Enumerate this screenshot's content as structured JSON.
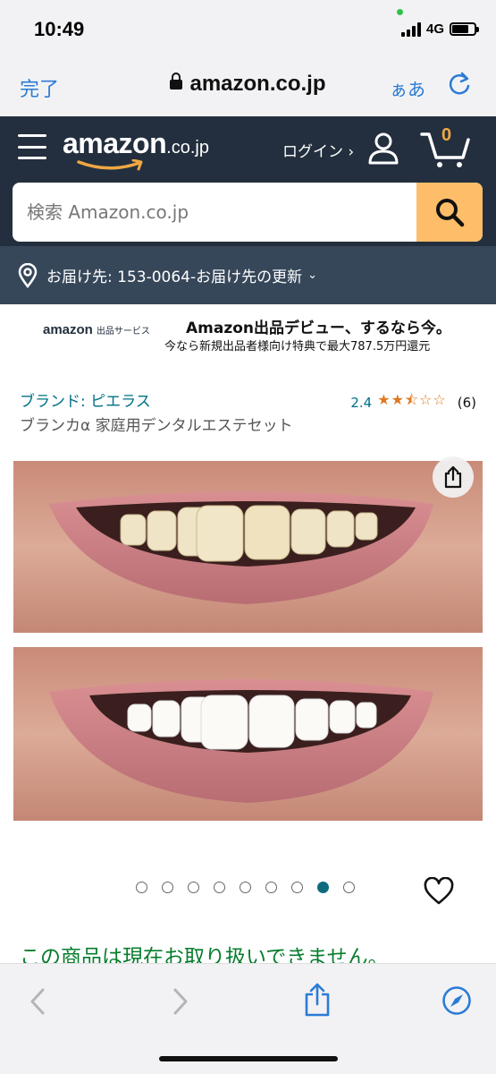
{
  "status_bar": {
    "time": "10:49",
    "network": "4G"
  },
  "browser": {
    "done_label": "完了",
    "url": "amazon.co.jp",
    "text_size_label": "ぁあ"
  },
  "amazon_header": {
    "logo_word": "amazon",
    "logo_tld": ".co.jp",
    "login_label": "ログイン ›",
    "cart_count": "0",
    "search_placeholder": "検索 Amazon.co.jp",
    "delivery_text": "お届け先: 153-0064-お届け先の更新",
    "delivery_chevron": "⌄"
  },
  "banner": {
    "logo": "amazon",
    "logo_suffix": "出品サービス",
    "title": "Amazon出品デビュー、するなら今。",
    "subtitle": "今なら新規出品者様向け特典で最大787.5万円還元"
  },
  "product": {
    "brand": "ブランド: ピエラス",
    "rating": "2.4",
    "rating_value": 2.4,
    "stars": "★★⯪☆☆",
    "review_count": "(6)",
    "title": "ブランカα 家庭用デンタルエステセット",
    "image_count": 9,
    "active_image_index": 7,
    "availability": "この商品は現在お取り扱いできません。"
  },
  "colors": {
    "amazon_dark": "#232f3e",
    "amazon_subbar": "#37475a",
    "search_button": "#febd69",
    "link": "#007185",
    "availability": "#067d2c",
    "ios_blue": "#2a7bd6"
  },
  "icons": [
    "lock-icon",
    "reload-icon",
    "hamburger-icon",
    "user-icon",
    "cart-icon",
    "search-icon",
    "location-pin-icon",
    "share-icon",
    "heart-icon",
    "back-icon",
    "forward-icon",
    "compass-icon"
  ]
}
